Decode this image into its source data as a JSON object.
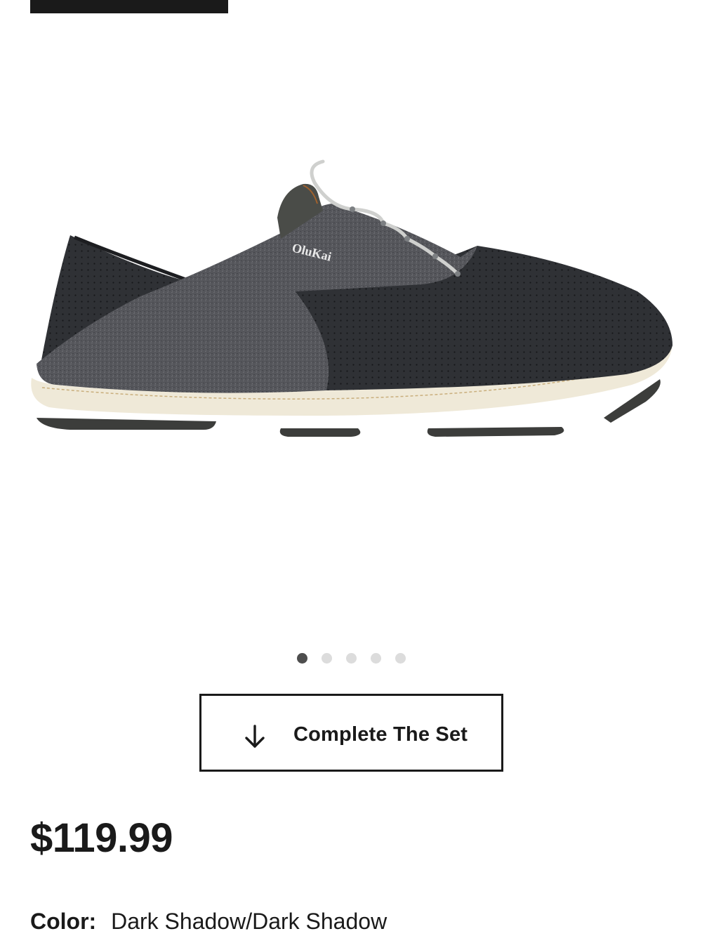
{
  "product": {
    "image_alt": "OluKai shoe",
    "brand_mark": "OluKai",
    "carousel": {
      "count": 5,
      "active_index": 0
    },
    "complete_set": {
      "label": "Complete The Set",
      "icon": "arrow-down-icon"
    },
    "price": "$119.99",
    "color": {
      "label": "Color:",
      "value": "Dark Shadow/Dark Shadow"
    }
  },
  "colors": {
    "upper_heather": "#55565b",
    "mesh": "#2d2f33",
    "sole": "#efe9d8",
    "outsole": "#3c3d3b",
    "text": "#1a1a1a",
    "dot_active": "#4e4e4e",
    "dot_inactive": "#dcdcdc"
  }
}
